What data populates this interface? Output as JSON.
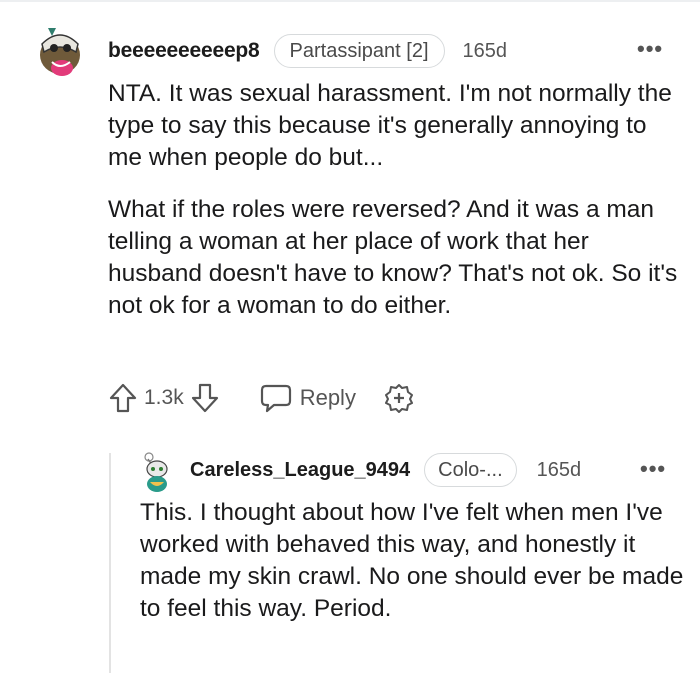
{
  "comment": {
    "username": "beeeeeeeeeep8",
    "flair": "Partassipant [2]",
    "time": "165d",
    "more": "•••",
    "paragraphs": [
      "NTA. It was sexual harassment. I'm not normally the type to say this because it's generally annoying to me when people do but...",
      "What if the roles were reversed? And it was a man telling a woman at her place of work that her husband doesn't have to know? That's not ok. So it's not ok for a woman to do either."
    ],
    "votes": "1.3k",
    "reply_label": "Reply",
    "icons": {
      "upvote": "arrow-up-icon",
      "downvote": "arrow-down-icon",
      "reply": "speech-bubble-icon",
      "award": "add-award-icon"
    }
  },
  "reply": {
    "username": "Careless_League_9494",
    "flair": "Colo-...",
    "time": "165d",
    "more": "•••",
    "body": "This. I thought about how I've felt when men I've worked with behaved this way, and honestly it made my skin crawl. No one should ever be made to feel this way. Period."
  },
  "colors": {
    "text": "#1a1a1b",
    "meta": "#555555",
    "border": "#d7dadc",
    "thread_line": "#e3e3e3"
  }
}
